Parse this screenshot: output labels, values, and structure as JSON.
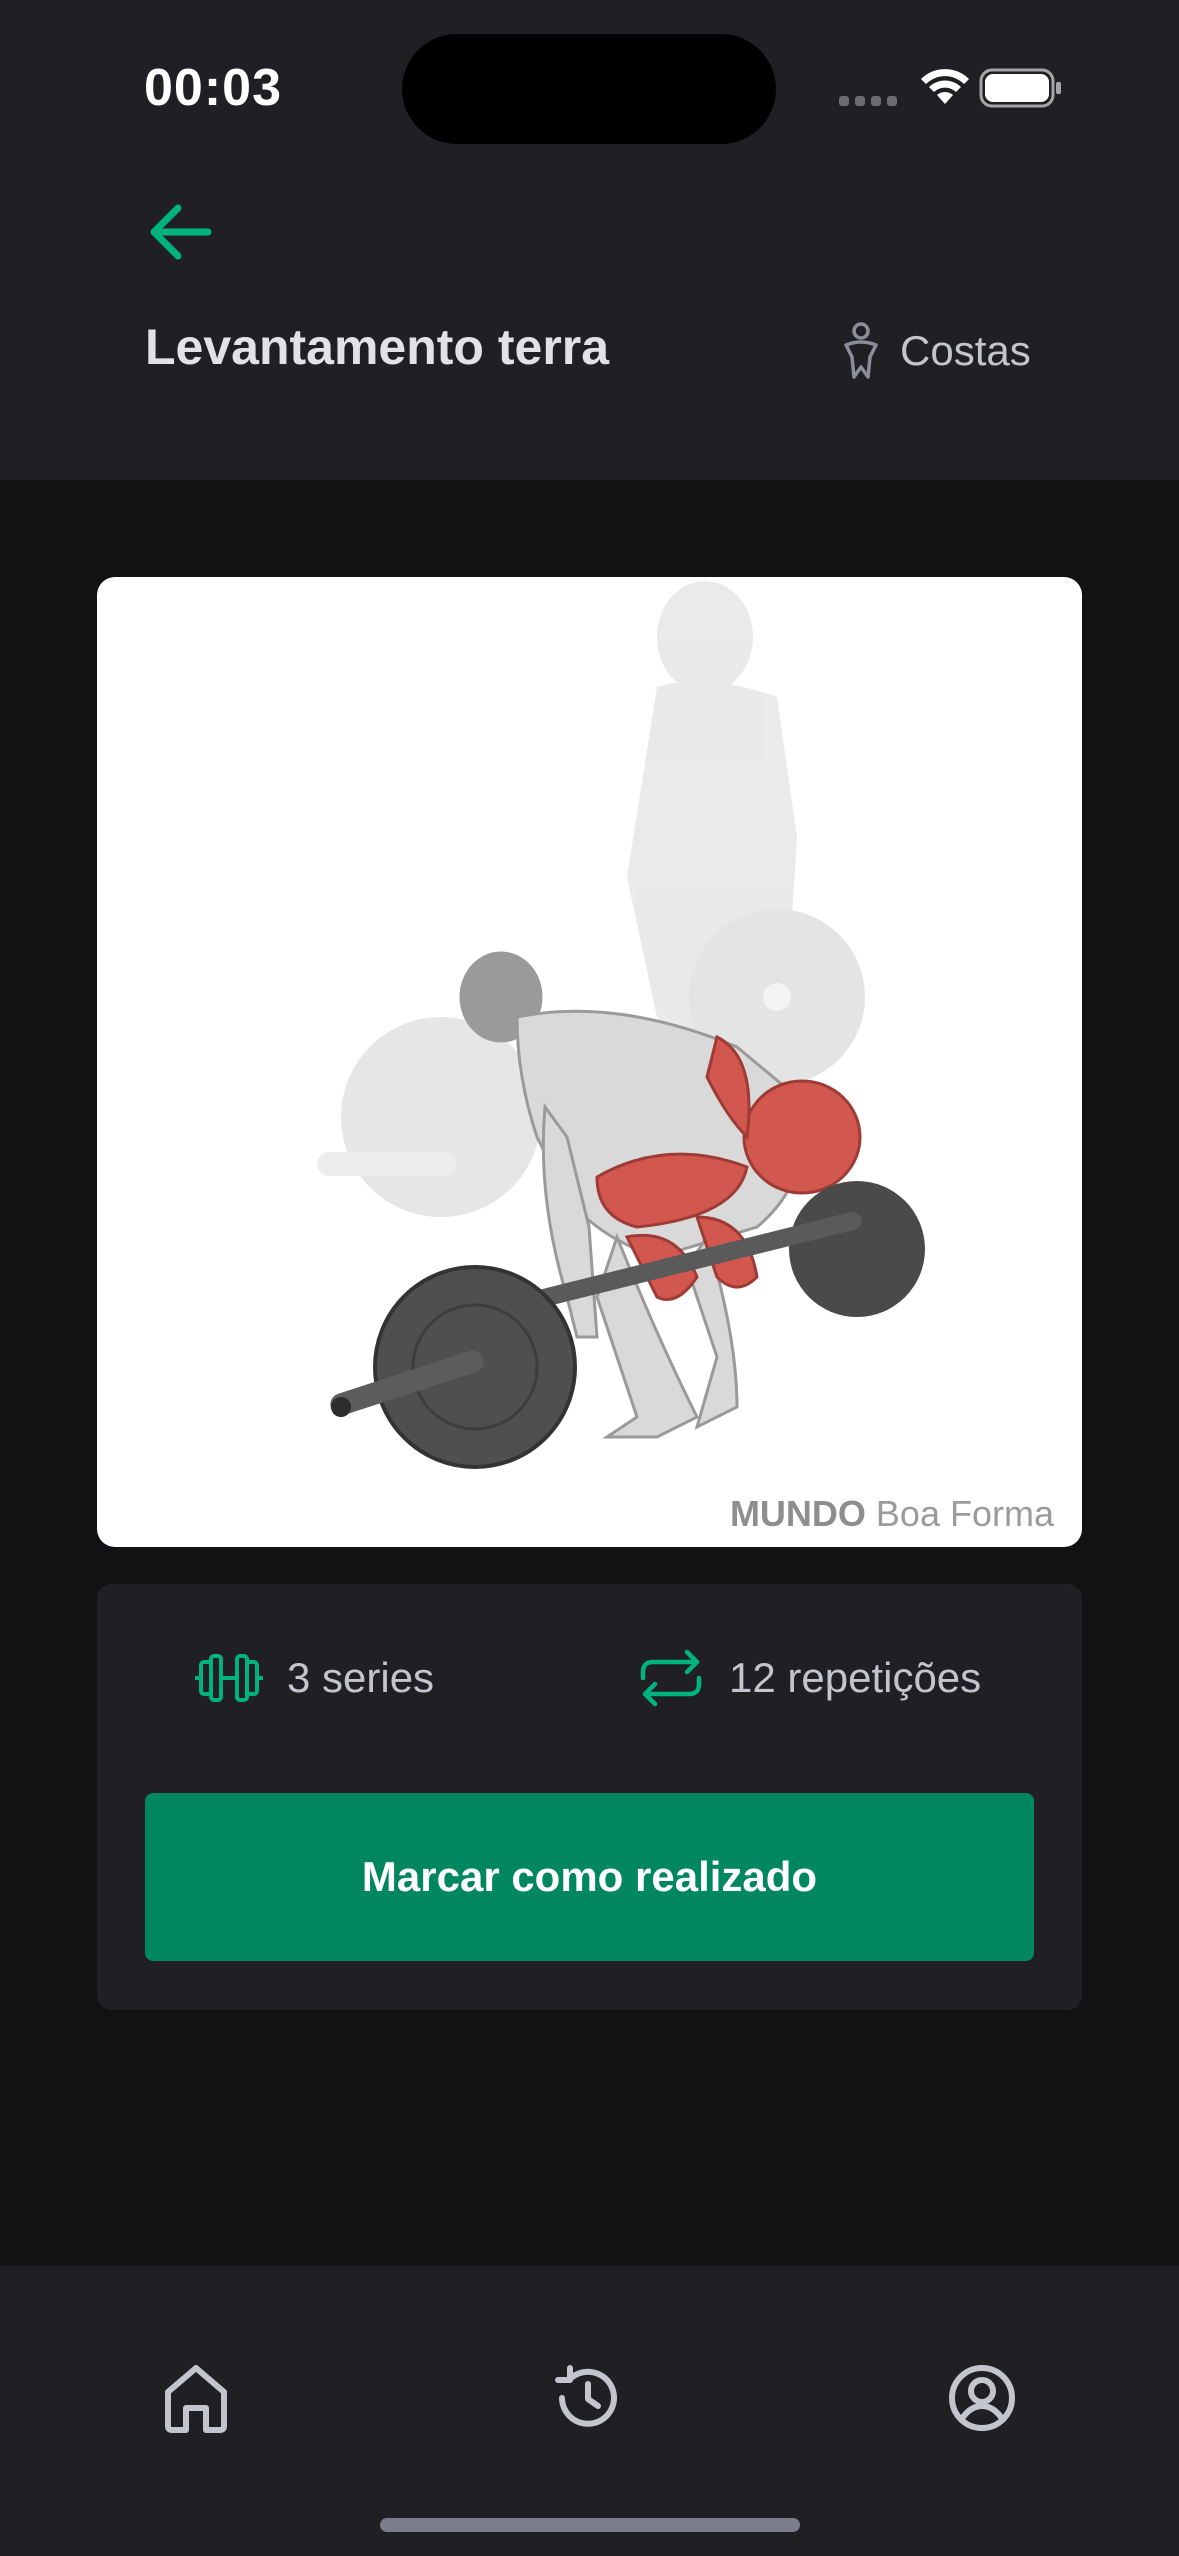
{
  "status_bar": {
    "time": "00:03"
  },
  "header": {
    "back_icon": "arrow-left-icon",
    "title": "Levantamento terra",
    "group": {
      "icon": "body-icon",
      "label": "Costas"
    }
  },
  "exercise_image": {
    "description_icon": "deadlift-illustration",
    "watermark_bold": "MUNDO",
    "watermark_rest": " Boa Forma"
  },
  "stats": {
    "series": {
      "icon": "dumbbell-icon",
      "label": "3 series"
    },
    "repetitions": {
      "icon": "repeat-icon",
      "label": "12 repetições"
    }
  },
  "actions": {
    "mark_done_label": "Marcar como realizado"
  },
  "tabbar": {
    "items": [
      {
        "icon": "home-icon",
        "name": "home"
      },
      {
        "icon": "history-icon",
        "name": "history"
      },
      {
        "icon": "profile-icon",
        "name": "profile"
      }
    ]
  },
  "colors": {
    "background": "#121214",
    "surface": "#202024",
    "accent": "#00b37e",
    "button": "#00875f",
    "text": "#e1e1e6",
    "muted": "#c4c4cc"
  }
}
